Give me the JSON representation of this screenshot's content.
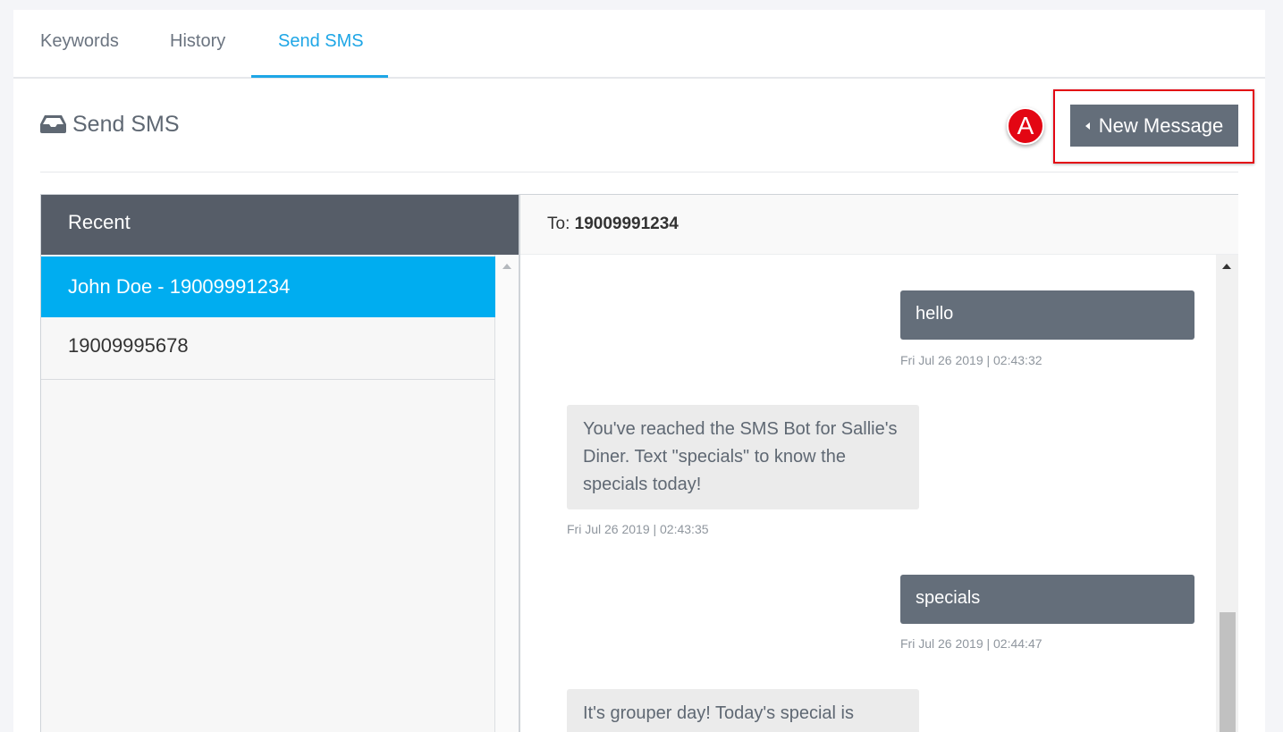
{
  "tabs": [
    {
      "label": "Keywords"
    },
    {
      "label": "History"
    },
    {
      "label": "Send SMS"
    }
  ],
  "section": {
    "title": "Send SMS",
    "icon": "inbox-icon"
  },
  "annotation": {
    "badge": "A"
  },
  "new_message_button": {
    "label": "New Message"
  },
  "recent": {
    "header": "Recent",
    "items": [
      {
        "label": "John Doe - 19009991234"
      },
      {
        "label": "19009995678"
      }
    ]
  },
  "conversation": {
    "to_label": "To:",
    "to_number": "19009991234",
    "messages": [
      {
        "direction": "out",
        "text": "hello",
        "time": "Fri Jul 26 2019 | 02:43:32"
      },
      {
        "direction": "in",
        "text": "You've reached the SMS Bot for Sallie's Diner. Text \"specials\" to know the specials today!",
        "time": "Fri Jul 26 2019 | 02:43:35"
      },
      {
        "direction": "out",
        "text": "specials",
        "time": "Fri Jul 26 2019 | 02:44:47"
      },
      {
        "direction": "in",
        "text": "It's grouper day! Today's special is",
        "time": ""
      }
    ]
  },
  "colors": {
    "accent": "#1ea6e6",
    "selected": "#00adf0",
    "header": "#565d68",
    "button": "#646e7a",
    "annotation": "#e30613"
  }
}
